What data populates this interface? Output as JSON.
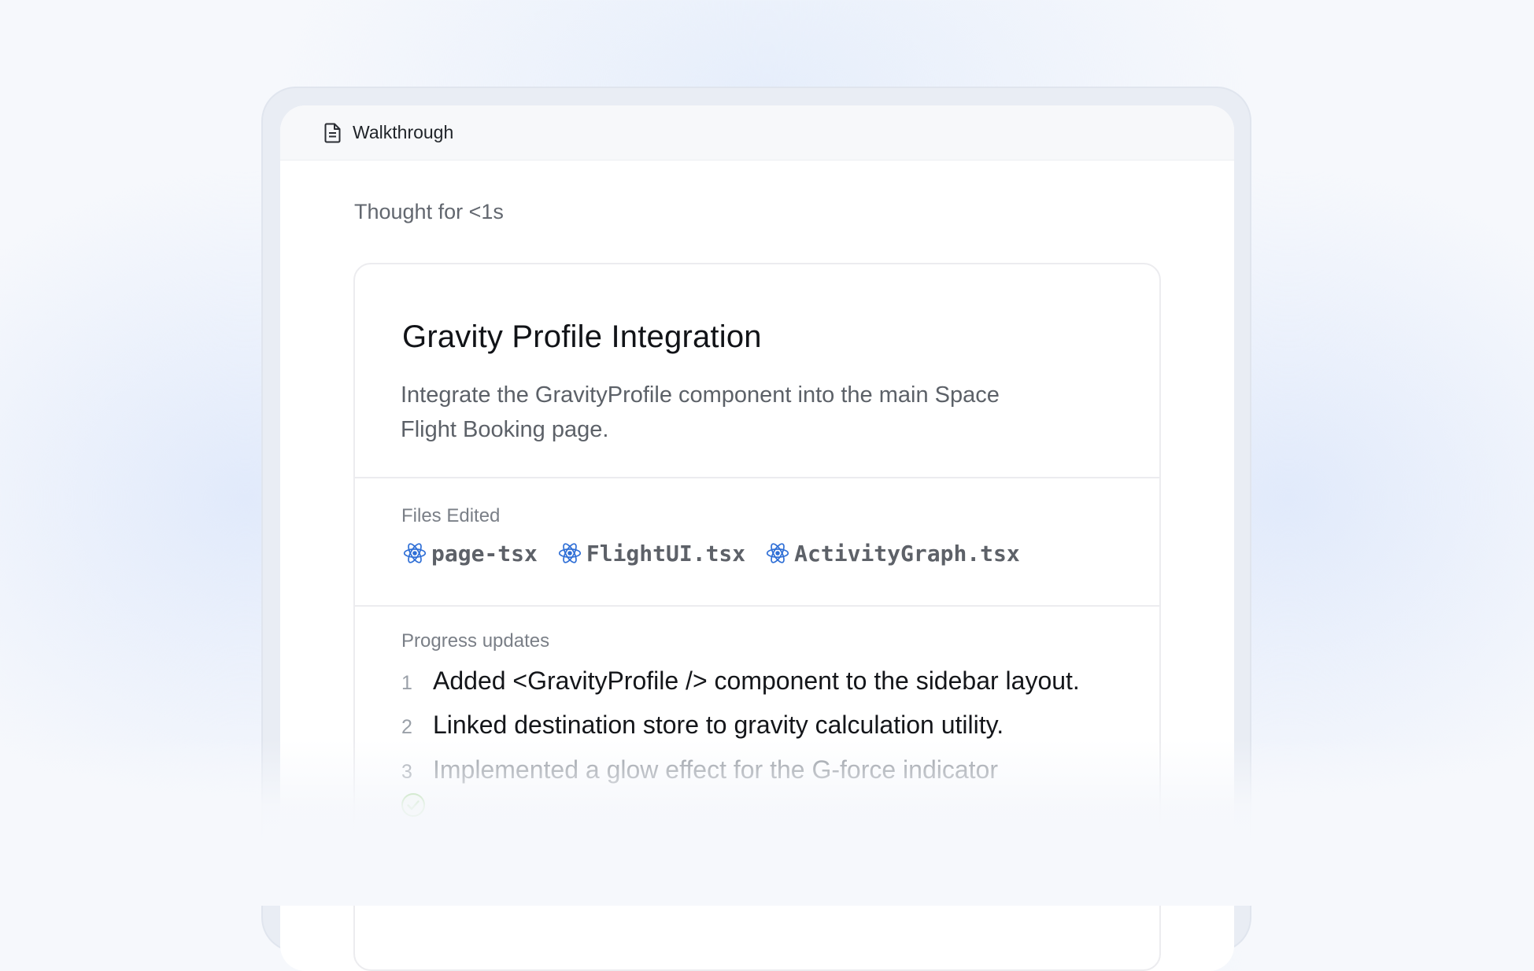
{
  "window": {
    "title": "Walkthrough",
    "title_icon": "document-icon"
  },
  "thought": "Thought for <1s",
  "card": {
    "title": "Gravity Profile Integration",
    "description": "Integrate the GravityProfile component into the main Space Flight Booking page.",
    "files_label": "Files Edited",
    "files": [
      {
        "name": "page-tsx",
        "icon": "react-icon"
      },
      {
        "name": "FlightUI.tsx",
        "icon": "react-icon"
      },
      {
        "name": "ActivityGraph.tsx",
        "icon": "react-icon"
      }
    ],
    "progress_label": "Progress updates",
    "updates": [
      {
        "num": "1",
        "text": "Added <GravityProfile /> component to the sidebar layout."
      },
      {
        "num": "2",
        "text": "Linked destination store to gravity calculation utility."
      },
      {
        "num": "3",
        "text": "Implemented a glow effect for the G-force indicator"
      }
    ]
  },
  "colors": {
    "react_blue": "#2f6fd6",
    "check_green": "#6bbf4a"
  }
}
